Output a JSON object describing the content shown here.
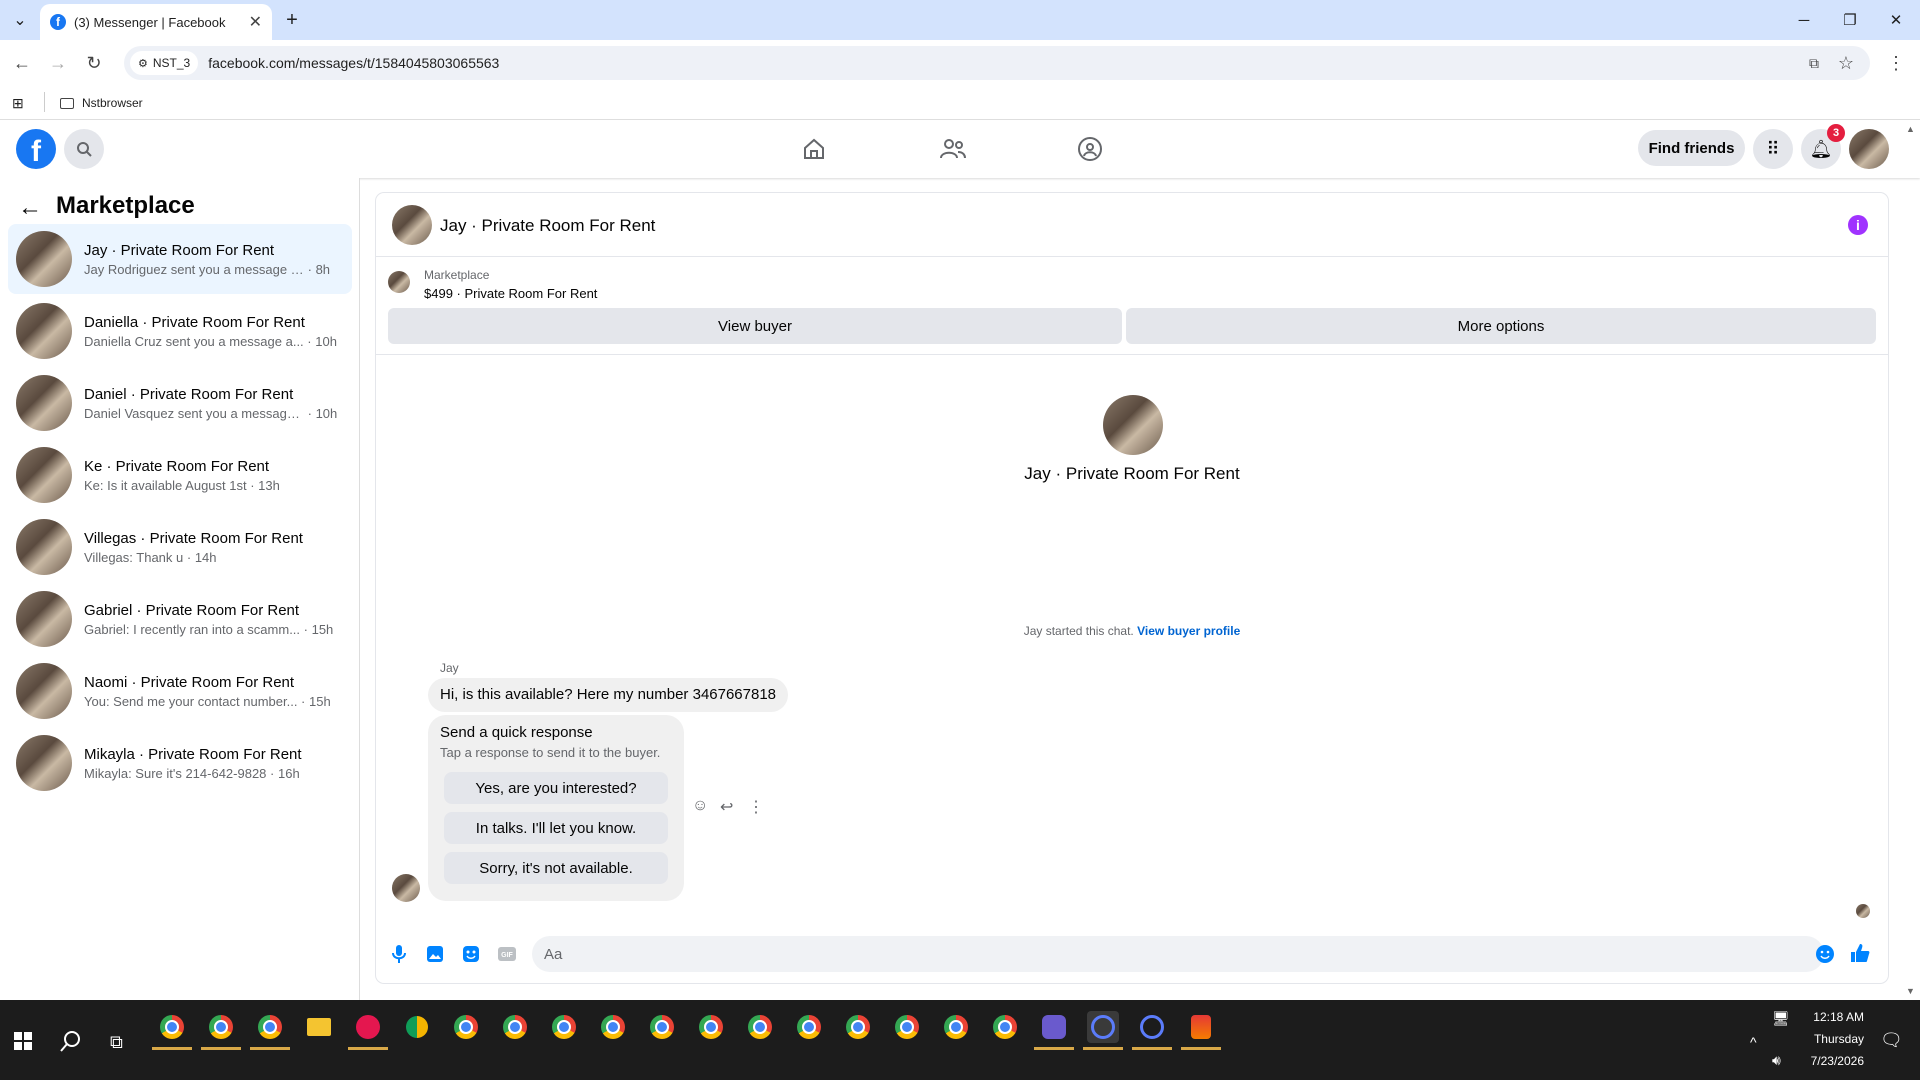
{
  "browser": {
    "tab_title": "(3) Messenger | Facebook",
    "profile_chip": "NST_3",
    "url": "facebook.com/messages/t/1584045803065563",
    "bookmark_folder": "Nstbrowser"
  },
  "header": {
    "find_friends": "Find friends",
    "notification_count": "3"
  },
  "sidebar": {
    "title": "Marketplace",
    "conversations": [
      {
        "name": "Jay · Private Room For Rent",
        "preview": "Jay Rodriguez sent you a message a...",
        "time": "8h"
      },
      {
        "name": "Daniella · Private Room For Rent",
        "preview": "Daniella Cruz sent you a message a...",
        "time": "10h"
      },
      {
        "name": "Daniel · Private Room For Rent",
        "preview": "Daniel Vasquez sent you a message...",
        "time": "10h"
      },
      {
        "name": "Ke · Private Room For Rent",
        "preview": "Ke: Is it available August 1st",
        "time": "13h"
      },
      {
        "name": "Villegas · Private Room For Rent",
        "preview": "Villegas: Thank u",
        "time": "14h"
      },
      {
        "name": "Gabriel · Private Room For Rent",
        "preview": "Gabriel: I recently ran into a scamm...",
        "time": "15h"
      },
      {
        "name": "Naomi · Private Room For Rent",
        "preview": "You: Send me your contact number...",
        "time": "15h"
      },
      {
        "name": "Mikayla · Private Room For Rent",
        "preview": "Mikayla: Sure it's 214-642-9828",
        "time": "16h"
      }
    ]
  },
  "chat": {
    "title": "Jay · Private Room For Rent",
    "listing_label": "Marketplace",
    "listing_title": "$499 · Private Room For Rent",
    "view_buyer": "View buyer",
    "more_options": "More options",
    "profile_name": "Jay · Private Room For Rent",
    "started_text": "Jay started this chat.",
    "view_buyer_profile": "View buyer profile",
    "sender": "Jay",
    "message": "Hi, is this available? Here my number 3467667818",
    "quick_title": "Send a quick response",
    "quick_sub": "Tap a response to send it to the buyer.",
    "quick_responses": [
      "Yes, are you interested?",
      "In talks. I'll let you know.",
      "Sorry, it's not available."
    ],
    "composer_placeholder": "Aa"
  },
  "taskbar": {
    "time": "12:18 AM",
    "day": "Thursday",
    "date": "7/23/2026"
  },
  "colors": {
    "brand": "#1877f2",
    "accent": "#0084ff",
    "info": "#a033ff",
    "badge": "#e41e3f"
  }
}
